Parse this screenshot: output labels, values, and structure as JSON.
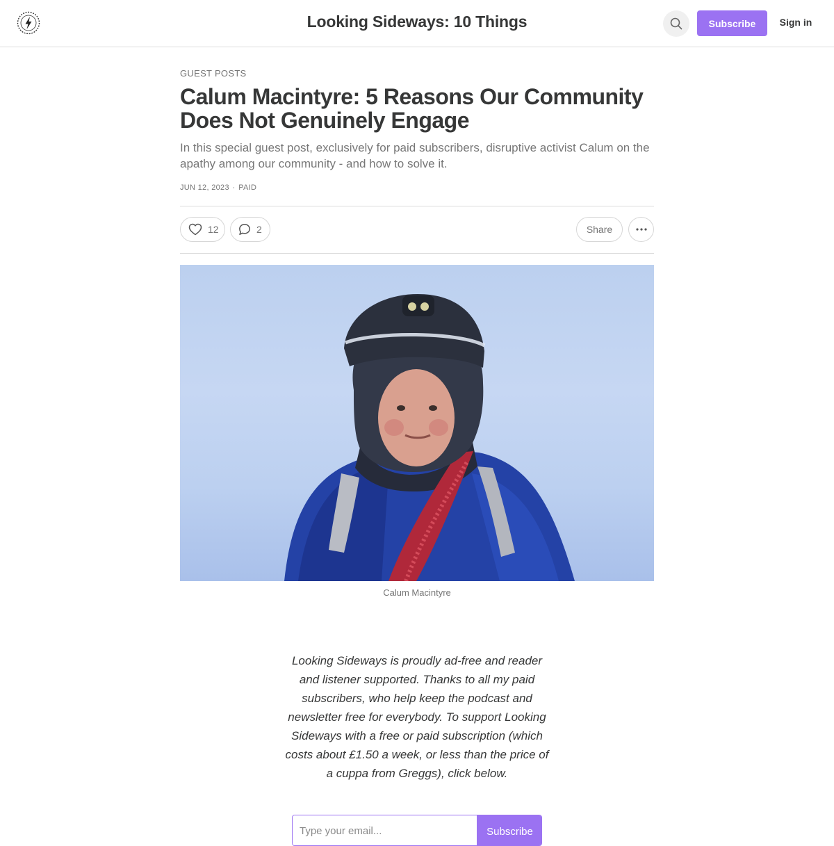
{
  "header": {
    "site_title": "Looking Sideways: 10 Things",
    "subscribe_label": "Subscribe",
    "signin_label": "Sign in",
    "logo_icon": "lightning-bolt-badge-icon",
    "search_icon": "search-icon"
  },
  "post": {
    "section": "GUEST POSTS",
    "title": "Calum Macintyre: 5 Reasons Our Community Does Not Genuinely Engage",
    "subtitle": "In this special guest post, exclusively for paid subscribers, disruptive activist Calum on the apathy among our community - and how to solve it.",
    "date": "JUN 12, 2023",
    "separator": "∙",
    "audience": "PAID"
  },
  "actions": {
    "likes": "12",
    "comments": "2",
    "share_label": "Share",
    "like_icon": "heart-icon",
    "comment_icon": "comment-bubble-icon",
    "more_icon": "ellipsis-icon"
  },
  "image": {
    "caption": "Calum Macintyre"
  },
  "promo": {
    "text": "Looking Sideways is proudly ad-free and reader and listener supported. Thanks to all my paid subscribers, who help keep the podcast and newsletter free for everybody. To support Looking Sideways with a free or paid subscription (which costs about £1.50 a week, or less than the price of a cuppa from Greggs), click below."
  },
  "subscribe_form": {
    "placeholder": "Type your email...",
    "button_label": "Subscribe"
  },
  "colors": {
    "accent": "#9b72f2",
    "text": "#363737",
    "muted": "#757575"
  }
}
